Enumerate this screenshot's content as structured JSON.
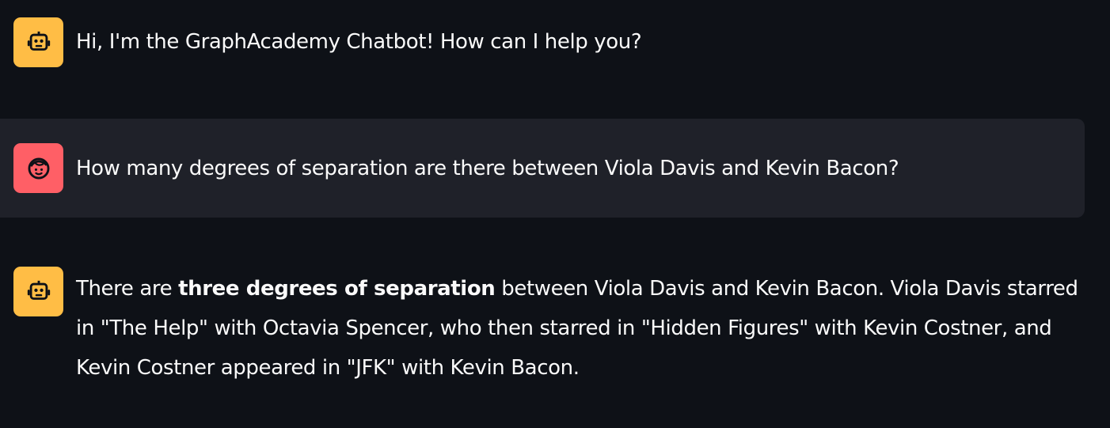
{
  "messages": [
    {
      "role": "assistant",
      "avatar_icon": "robot-icon",
      "text": "Hi, I'm the GraphAcademy Chatbot! How can I help you?"
    },
    {
      "role": "user",
      "avatar_icon": "smiley-face-icon",
      "text": "How many degrees of separation are there between Viola Davis and Kevin Bacon?"
    },
    {
      "role": "assistant",
      "avatar_icon": "robot-icon",
      "text_prefix": "There are ",
      "text_bold": "three degrees of separation",
      "text_suffix": " between Viola Davis and Kevin Bacon. Viola Davis starred in \"The Help\" with Octavia Spencer, who then starred in \"Hidden Figures\" with Kevin Costner, and Kevin Costner appeared in \"JFK\" with Kevin Bacon."
    }
  ],
  "colors": {
    "background": "#0e1117",
    "user_bubble": "#1f2129",
    "assistant_avatar": "#ffbd45",
    "user_avatar": "#ff5f66",
    "text": "#fafafa"
  }
}
